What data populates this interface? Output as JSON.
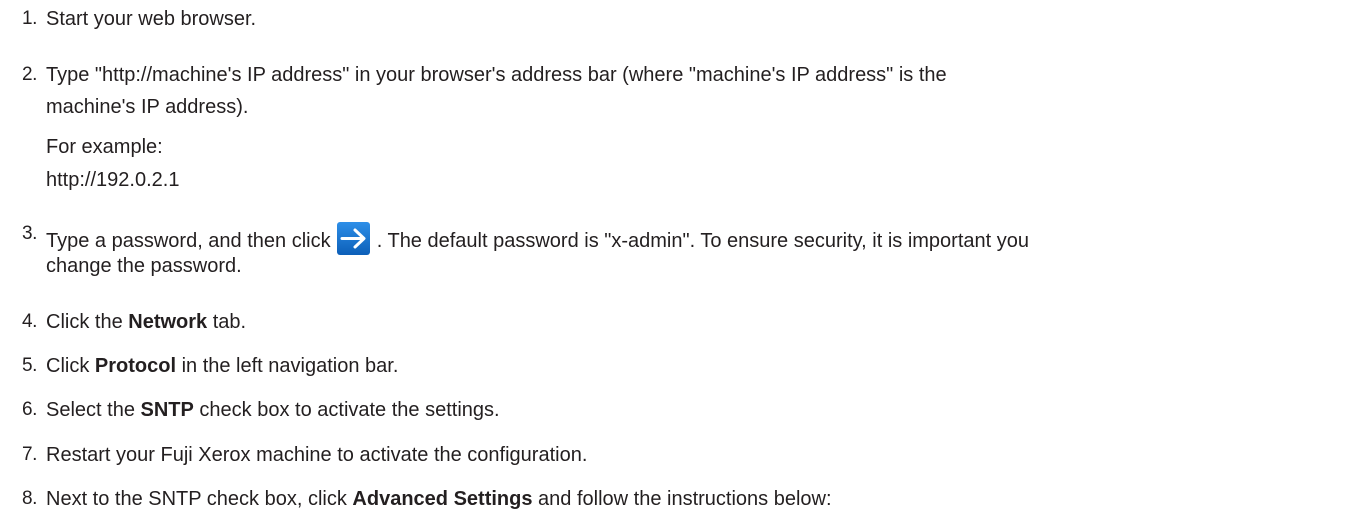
{
  "steps": [
    {
      "num": "1.",
      "text": "Start your web browser."
    },
    {
      "num": "2.",
      "line1": "Type \"http://machine's IP address\" in your browser's address bar (where \"machine's IP address\" is the",
      "line2": "machine's IP address).",
      "example_label": "For example:",
      "example_url": "http://192.0.2.1"
    },
    {
      "num": "3.",
      "line1_before": "Type a password, and then click ",
      "line1_after": ". The default password is \"x-admin\". To ensure security, it is important you",
      "line2": "change the password.",
      "icon": "arrow-right-icon",
      "icon_color": "#1565c0"
    },
    {
      "num": "4.",
      "before": "Click the ",
      "bold": "Network",
      "after": " tab."
    },
    {
      "num": "5.",
      "before": "Click ",
      "bold": "Protocol",
      "after": " in the left navigation bar."
    },
    {
      "num": "6.",
      "before": "Select the ",
      "bold": "SNTP",
      "after": " check box to activate the settings."
    },
    {
      "num": "7.",
      "text": "Restart your Fuji Xerox machine to activate the configuration."
    },
    {
      "num": "8.",
      "before": "Next to the SNTP check box, click ",
      "bold": "Advanced Settings",
      "after": " and follow the instructions below:"
    }
  ]
}
